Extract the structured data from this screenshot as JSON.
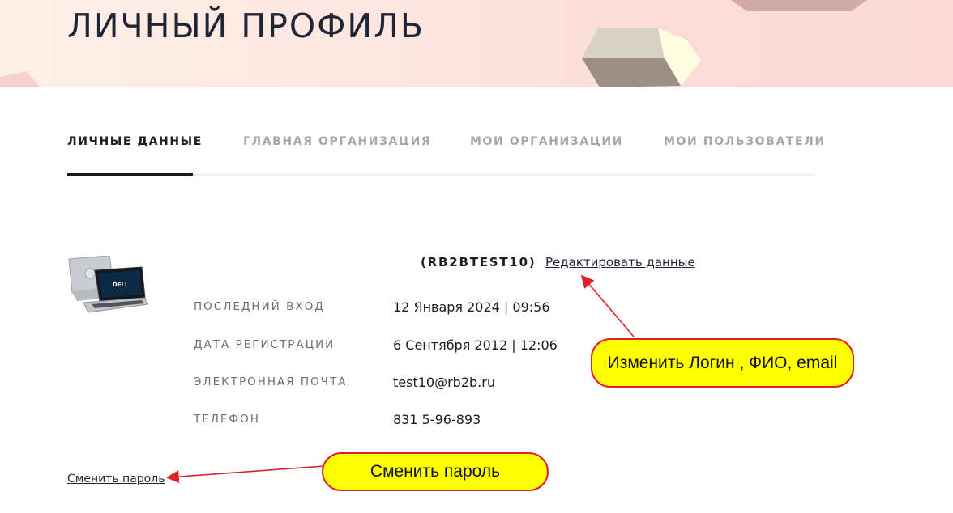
{
  "header": {
    "title": "ЛИЧНЫЙ ПРОФИЛЬ"
  },
  "tabs": [
    {
      "label": "ЛИЧНЫЕ ДАННЫЕ",
      "active": true
    },
    {
      "label": "ГЛАВНАЯ ОРГАНИЗАЦИЯ",
      "active": false
    },
    {
      "label": "МОИ ОРГАНИЗАЦИИ",
      "active": false
    },
    {
      "label": "МОИ ПОЛЬЗОВАТЕЛИ",
      "active": false
    }
  ],
  "profile": {
    "login": "(RB2BTEST10)",
    "edit_link": "Редактировать данные",
    "avatar_icon": "laptop-image",
    "fields": [
      {
        "label": "ПОСЛЕДНИЙ ВХОД",
        "value": "12 Января 2024 | 09:56"
      },
      {
        "label": "ДАТА РЕГИСТРАЦИИ",
        "value": "6 Сентября 2012 | 12:06"
      },
      {
        "label": "ЭЛЕКТРОННАЯ ПОЧТА",
        "value": "test10@rb2b.ru"
      },
      {
        "label": "ТЕЛЕФОН",
        "value": "831 5-96-893"
      }
    ],
    "change_password": "Сменить пароль"
  },
  "annotations": {
    "edit_callout": "Изменить Логин , ФИО, email",
    "password_callout": "Сменить пароль"
  },
  "colors": {
    "callout_fill": "#ffff00",
    "callout_border": "#e0202a",
    "arrow": "#e0202a"
  }
}
